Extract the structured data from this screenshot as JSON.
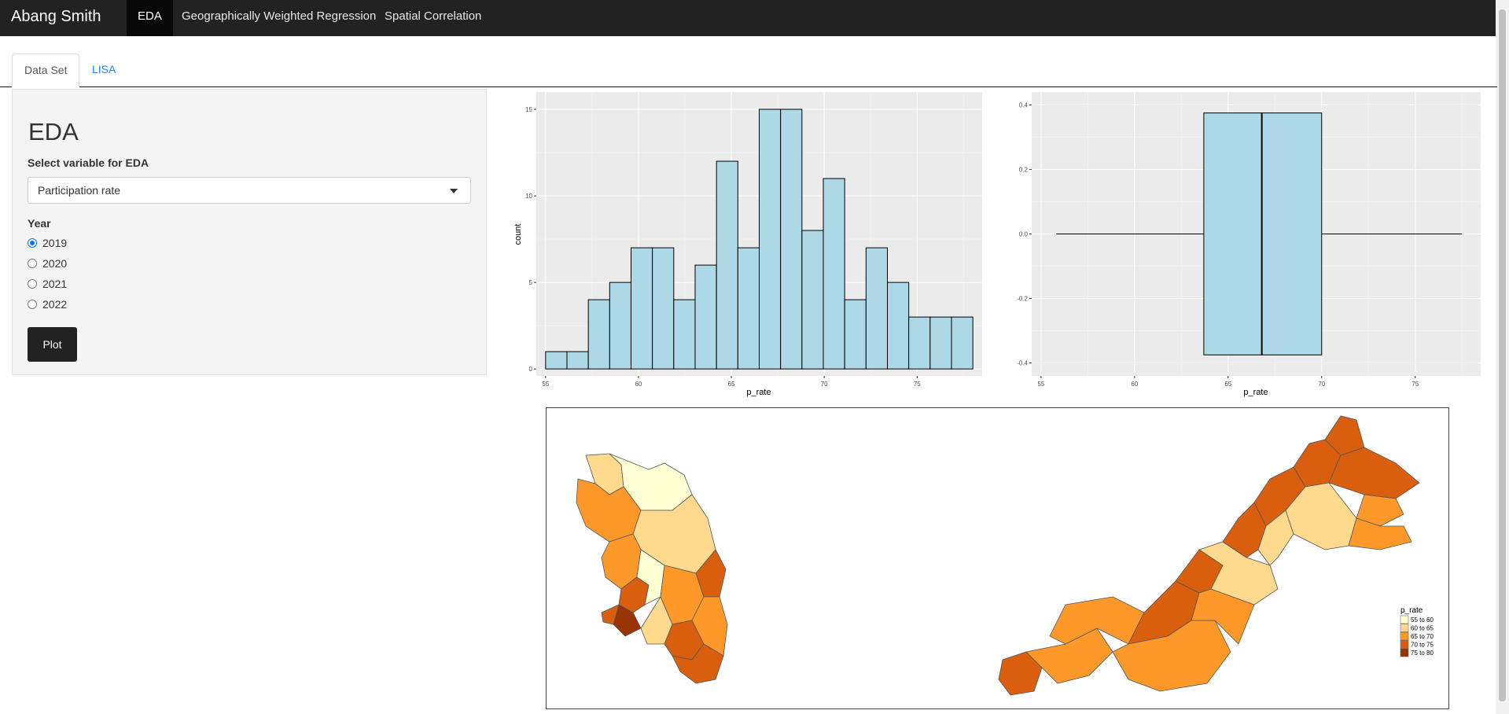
{
  "navbar": {
    "brand": "Abang Smith",
    "items": [
      {
        "label": "EDA",
        "active": true
      },
      {
        "label": "Geographically Weighted Regression",
        "active": false
      },
      {
        "label": "Spatial Correlation",
        "active": false
      }
    ]
  },
  "tabs": [
    {
      "label": "Data Set",
      "active": true
    },
    {
      "label": "LISA",
      "active": false
    }
  ],
  "sidebar": {
    "title": "EDA",
    "select_label": "Select variable for EDA",
    "select_value": "Participation rate",
    "year_label": "Year",
    "years": [
      "2019",
      "2020",
      "2021",
      "2022"
    ],
    "selected_year": "2019",
    "plot_button": "Plot"
  },
  "histogram": {
    "xlabel": "p_rate",
    "ylabel": "count",
    "x_ticks": [
      "55",
      "60",
      "65",
      "70",
      "75"
    ],
    "y_ticks": [
      "0",
      "5",
      "10",
      "15"
    ]
  },
  "boxplot": {
    "xlabel": "p_rate",
    "x_ticks": [
      "55",
      "60",
      "65",
      "70",
      "75"
    ],
    "y_ticks": [
      "0.4",
      "0.2",
      "0.0",
      "-0.2",
      "-0.4"
    ]
  },
  "map": {
    "legend_title": "p_rate",
    "legend": [
      {
        "label": "55 to 60",
        "color": "#ffffd4"
      },
      {
        "label": "60 to 65",
        "color": "#fed98e"
      },
      {
        "label": "65 to 70",
        "color": "#fe9929"
      },
      {
        "label": "70 to 75",
        "color": "#d95f0e"
      },
      {
        "label": "75 to 80",
        "color": "#993404"
      }
    ]
  },
  "chart_data": [
    {
      "type": "bar",
      "xlabel": "p_rate",
      "ylabel": "count",
      "bin_start": 55.0,
      "bin_width": 1.15,
      "values": [
        1,
        1,
        4,
        5,
        7,
        7,
        4,
        6,
        12,
        7,
        15,
        15,
        8,
        11,
        4,
        7,
        5,
        3,
        3,
        3
      ],
      "xlim": [
        54.5,
        78.5
      ],
      "ylim": [
        -0.4,
        16
      ],
      "grid": true,
      "fill": "#add8e6"
    },
    {
      "type": "boxplot",
      "xlabel": "p_rate",
      "min": 55.8,
      "q1": 63.7,
      "median": 66.8,
      "q3": 70.0,
      "max": 77.5,
      "xlim": [
        54.5,
        78.5
      ],
      "ylim": [
        -0.4,
        0.4
      ],
      "grid": true,
      "fill": "#add8e6"
    }
  ]
}
